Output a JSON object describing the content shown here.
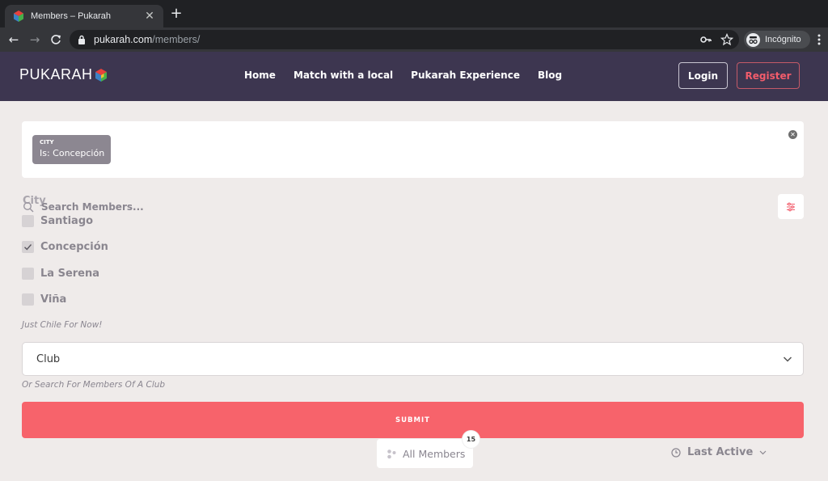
{
  "browser": {
    "tab_title": "Members – Pukarah",
    "url_host": "pukarah.com",
    "url_path": "/members/",
    "profile_label": "Incógnito"
  },
  "site": {
    "logo_text": "PUKARAH",
    "nav": [
      "Home",
      "Match with a local",
      "Pukarah Experience",
      "Blog"
    ],
    "login_label": "Login",
    "register_label": "Register",
    "colors": {
      "header": "#3d3650",
      "accent": "#f7636b",
      "register": "#f25c6b"
    }
  },
  "filters": {
    "chip_key": "CITY",
    "chip_value": "Is: Concepción",
    "city_label": "City",
    "search_placeholder": "Search Members...",
    "cities": [
      {
        "label": "Santiago",
        "checked": false
      },
      {
        "label": "Concepción",
        "checked": true
      },
      {
        "label": "La Serena",
        "checked": false
      },
      {
        "label": "Viña",
        "checked": false
      }
    ],
    "city_hint": "Just Chile For Now!",
    "club_value": "Club",
    "club_hint": "Or Search For Members Of A Club",
    "submit_label": "SUBMIT"
  },
  "results": {
    "all_members_label": "All Members",
    "count": "15",
    "sort_label": "Last Active"
  }
}
